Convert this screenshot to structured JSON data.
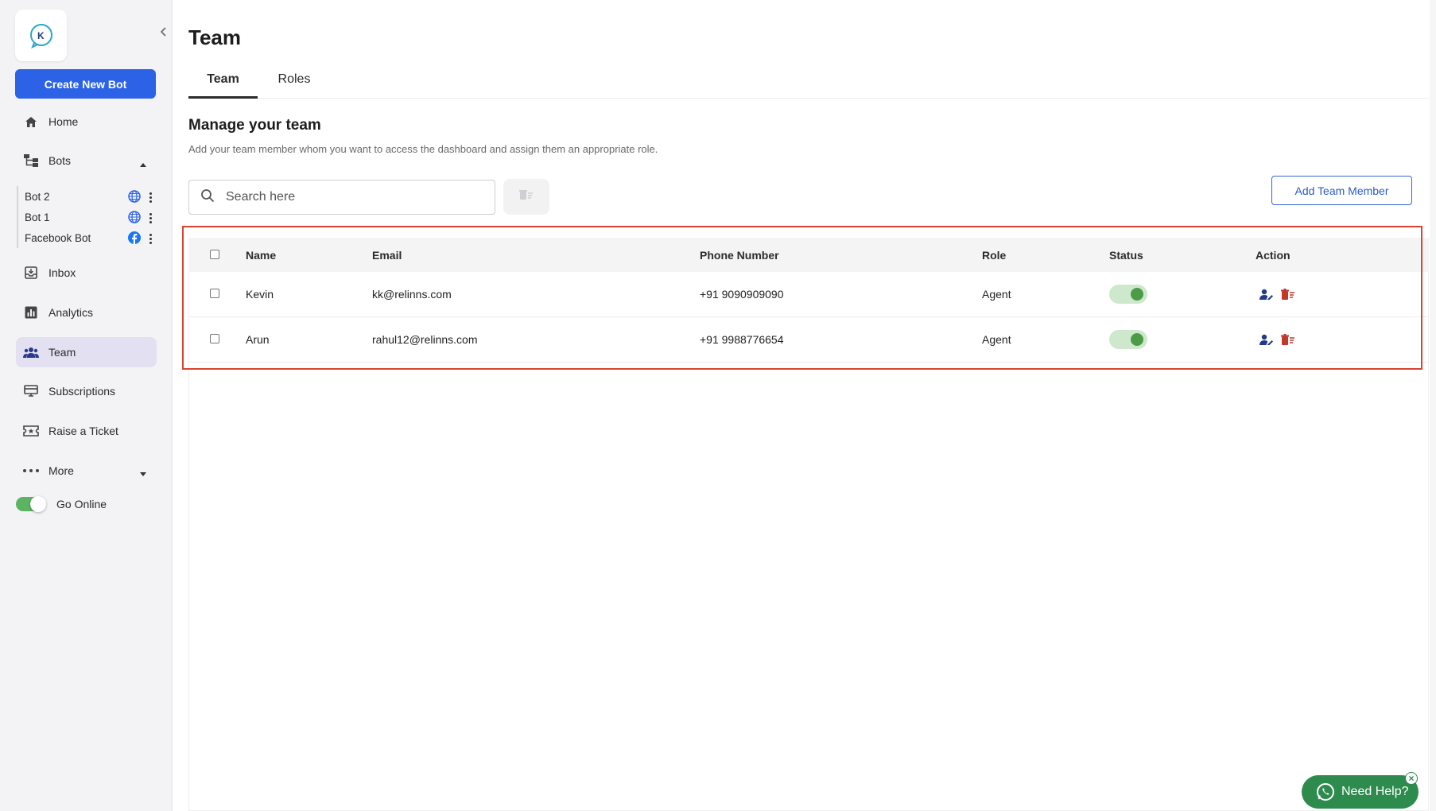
{
  "sidebar": {
    "create_bot_label": "Create New Bot",
    "nav": {
      "home": "Home",
      "bots": "Bots",
      "inbox": "Inbox",
      "analytics": "Analytics",
      "team": "Team",
      "subscriptions": "Subscriptions",
      "raise_ticket": "Raise a Ticket",
      "more": "More"
    },
    "bots": [
      {
        "name": "Bot 2",
        "channel_icon": "globe-icon"
      },
      {
        "name": "Bot 1",
        "channel_icon": "globe-icon"
      },
      {
        "name": "Facebook Bot",
        "channel_icon": "facebook-icon"
      }
    ],
    "go_online_label": "Go Online"
  },
  "header": {
    "title": "Team",
    "tabs": [
      {
        "label": "Team",
        "active": true
      },
      {
        "label": "Roles",
        "active": false
      }
    ]
  },
  "section": {
    "title": "Manage your team",
    "subtitle": "Add your team member whom you want to access the dashboard and assign them an appropriate role."
  },
  "search": {
    "placeholder": "Search here",
    "value": ""
  },
  "add_member_label": "Add Team Member",
  "table": {
    "columns": [
      "Name",
      "Email",
      "Phone Number",
      "Role",
      "Status",
      "Action"
    ],
    "rows": [
      {
        "name": "Kevin",
        "email": "kk@relinns.com",
        "phone": "+91 9090909090",
        "role": "Agent",
        "status_on": true
      },
      {
        "name": "Arun",
        "email": "rahul12@relinns.com",
        "phone": "+91 9988776654",
        "role": "Agent",
        "status_on": true
      }
    ]
  },
  "need_help_label": "Need Help?",
  "colors": {
    "primary": "#2c63e6",
    "highlight_border": "#d9432f",
    "status_green": "#4c9b47",
    "delete_red": "#c0392b",
    "whatsapp_green": "#2e8b4e"
  }
}
